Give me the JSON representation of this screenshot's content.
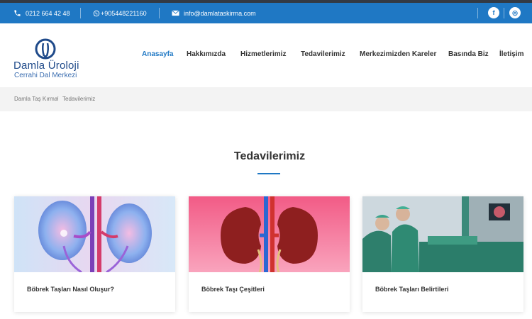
{
  "topbar": {
    "phone": "0212 664 42 48",
    "whatsapp": "+905448221160",
    "email": "info@damlataskirma.com",
    "social": [
      {
        "icon": "facebook-icon",
        "label": "f"
      },
      {
        "icon": "instagram-icon",
        "label": "◎"
      }
    ]
  },
  "logo": {
    "title": "Damla Üroloji",
    "subtitle": "Cerrahi Dal Merkezi"
  },
  "nav": {
    "items": [
      {
        "label": "Anasayfa",
        "active": true
      },
      {
        "label": "Hakkımızda"
      },
      {
        "label": "Hizmetlerimiz"
      },
      {
        "label": "Tedavilerimiz"
      },
      {
        "label": "Merkezimizden Kareler"
      },
      {
        "label": "Basında Biz"
      },
      {
        "label": "İletişim"
      }
    ]
  },
  "breadcrumb": {
    "home": "Damla Taş Kırma",
    "separator": "/",
    "current": "Tedavilerimiz"
  },
  "section": {
    "title": "Tedavilerimiz"
  },
  "cards": [
    {
      "title": "Böbrek Taşları Nasıl Oluşur?"
    },
    {
      "title": "Böbrek Taşı Çeşitleri"
    },
    {
      "title": "Böbrek Taşları Belirtileri"
    }
  ],
  "colors": {
    "accent": "#1f78c4",
    "topbar": "#1f78c4",
    "logo": "#1f4a8a"
  }
}
